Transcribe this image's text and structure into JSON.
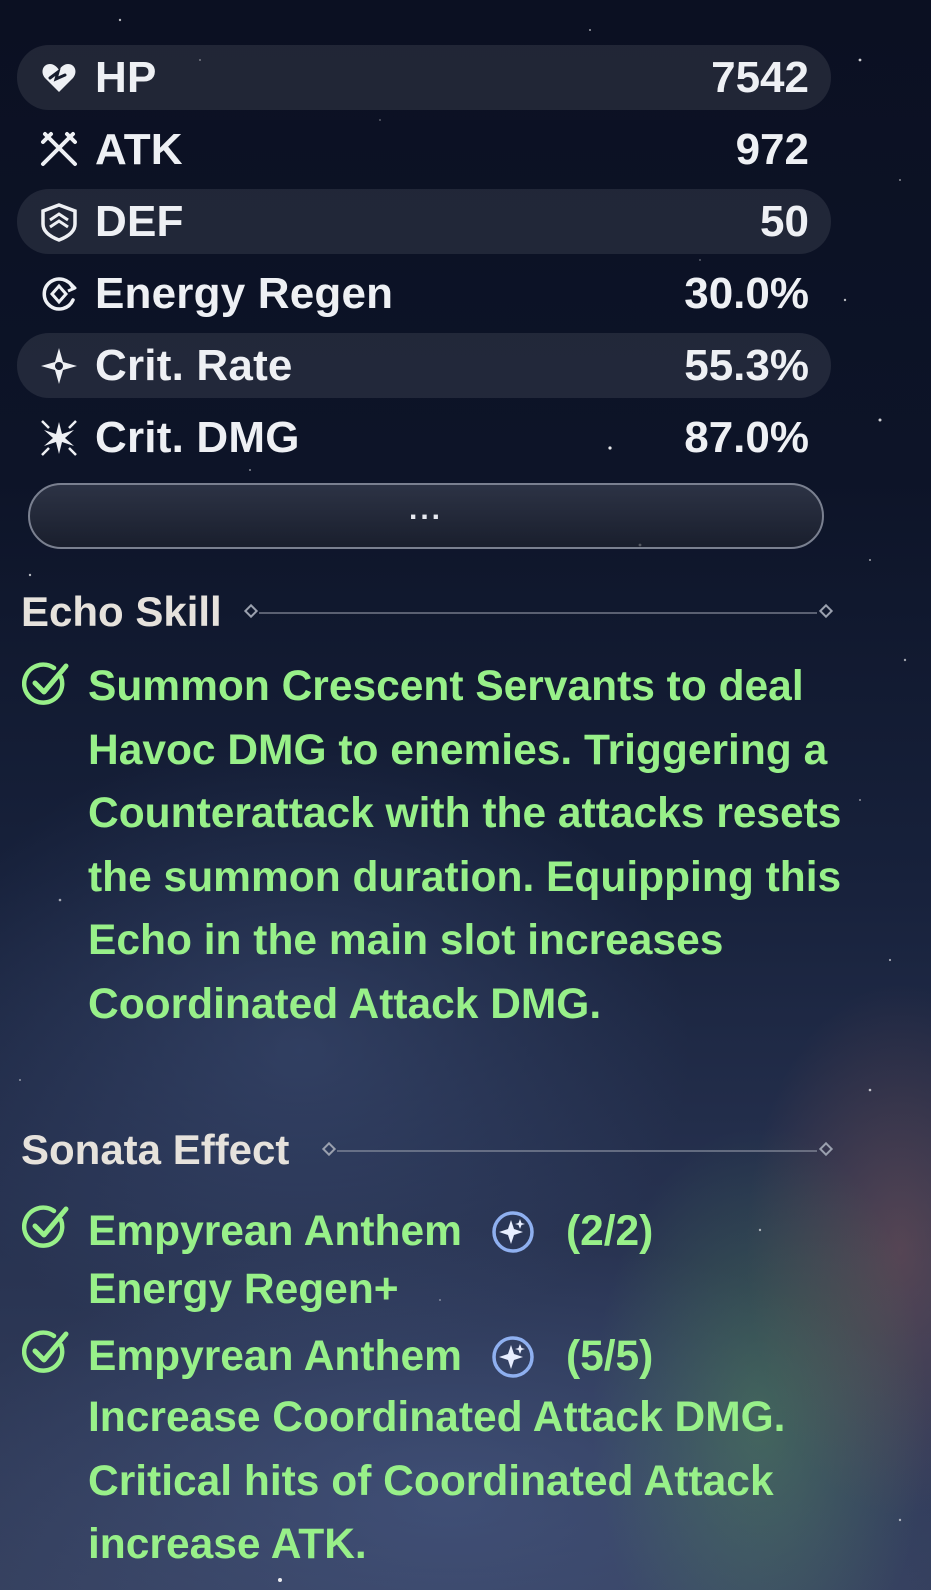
{
  "stats": [
    {
      "label": "HP",
      "value": "7542",
      "icon": "heart-icon"
    },
    {
      "label": "ATK",
      "value": "972",
      "icon": "crossed-swords-icon"
    },
    {
      "label": "DEF",
      "value": "50",
      "icon": "shield-icon"
    },
    {
      "label": "Energy Regen",
      "value": "30.0%",
      "icon": "energy-regen-icon"
    },
    {
      "label": "Crit. Rate",
      "value": "55.3%",
      "icon": "crit-rate-star-icon"
    },
    {
      "label": "Crit. DMG",
      "value": "87.0%",
      "icon": "crit-dmg-burst-icon"
    }
  ],
  "more_button": {
    "label": "..."
  },
  "echo_skill": {
    "title": "Echo Skill",
    "description": "Summon Crescent Servants to deal Havoc DMG to enemies. Triggering a Counterattack with the attacks resets the summon duration. Equipping this Echo in the main slot increases Coordinated Attack DMG."
  },
  "sonata_effect": {
    "title": "Sonata Effect",
    "items": [
      {
        "name": "Empyrean Anthem",
        "count": "(2/2)",
        "description": "Energy Regen+",
        "icon": "empyrean-anthem-sonata-icon"
      },
      {
        "name": "Empyrean Anthem",
        "count": "(5/5)",
        "description": "Increase Coordinated Attack DMG. Critical hits of Coordinated Attack increase ATK.",
        "icon": "empyrean-anthem-sonata-icon"
      }
    ]
  },
  "colors": {
    "effect_text": "#98f089",
    "stat_text": "#eef0f4",
    "section_title": "#e6e2dc",
    "sonata_icon": "#8fb0f0"
  }
}
